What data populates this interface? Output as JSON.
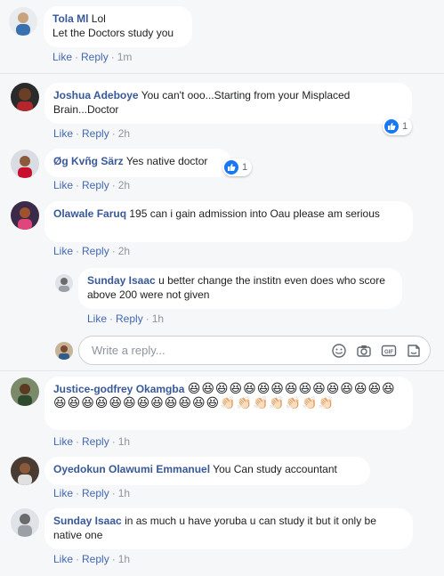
{
  "comments": [
    {
      "name": "Tola Ml",
      "text": "Lol\nLet the Doctors study you",
      "like": "Like",
      "reply": "Reply",
      "time": "1m"
    },
    {
      "name": "Joshua Adeboye",
      "text": "You can't ooo...Starting from your Misplaced Brain...Doctor",
      "like": "Like",
      "reply": "Reply",
      "time": "2h",
      "reactions": "1"
    },
    {
      "name": "Øg Kvñg Särz",
      "text": "Yes native doctor",
      "like": "Like",
      "reply": "Reply",
      "time": "2h",
      "reactions": "1"
    },
    {
      "name": "Olawale Faruq",
      "text": "195 can i gain admission into Oau please am serious",
      "like": "Like",
      "reply": "Reply",
      "time": "2h"
    },
    {
      "name": "Sunday Isaac",
      "text": "u better change the institn even does who score above 200 were not given",
      "like": "Like",
      "reply": "Reply",
      "time": "1h"
    },
    {
      "name": "Justice-godfrey Okamgba",
      "text": "😆😆😆😆😆😆😆😆😆😆😆😆😆😆😆😆😆😆😆😆😆😆😆😆😆😆😆👏🏻👏🏻👏🏻👏🏻👏🏻👏🏻👏🏻",
      "like": "Like",
      "reply": "Reply",
      "time": "1h"
    },
    {
      "name": "Oyedokun Olawumi Emmanuel",
      "text": "You Can study accountant",
      "like": "Like",
      "reply": "Reply",
      "time": "1h"
    },
    {
      "name": "Sunday Isaac",
      "text": "in as much u have yoruba u can study it but it only be native one",
      "like": "Like",
      "reply": "Reply",
      "time": "1h"
    }
  ],
  "reply_box": {
    "placeholder": "Write a reply..."
  },
  "icons": {
    "emoji": "smiley-icon",
    "camera": "camera-icon",
    "gif": "gif-icon",
    "sticker": "sticker-icon",
    "like": "thumbs-up-icon"
  },
  "colors": {
    "name": "#385898",
    "link": "#4267b2",
    "like_badge": "#1877f2",
    "bubble": "#ffffff",
    "background": "#f6f7f9"
  }
}
